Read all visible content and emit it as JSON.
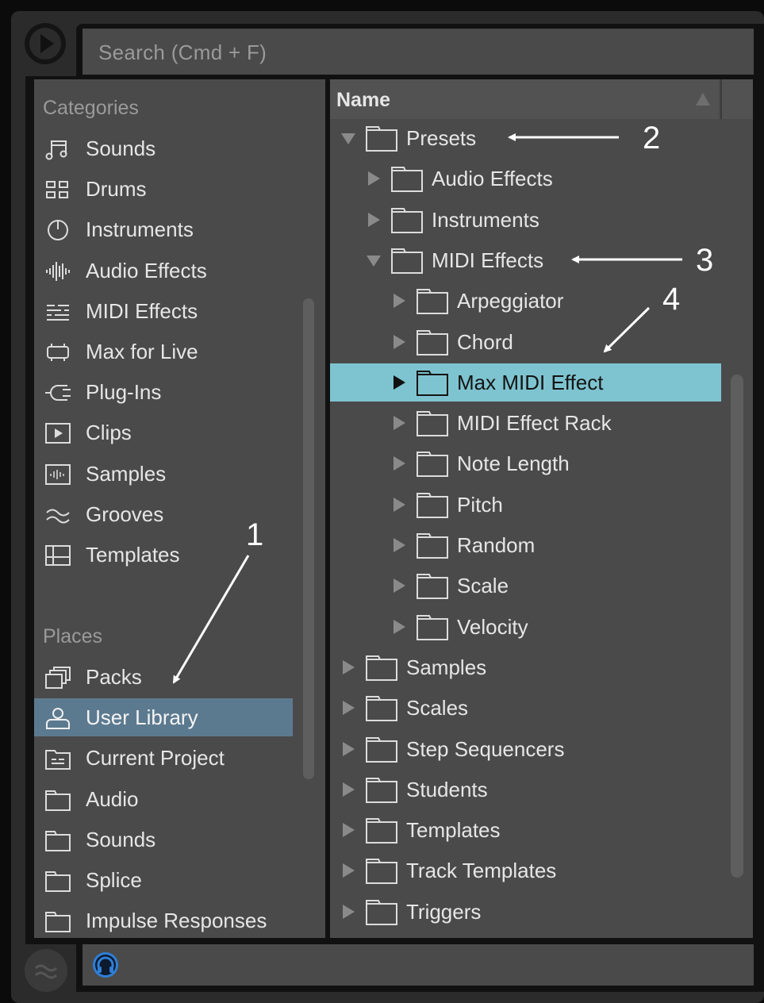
{
  "search": {
    "placeholder": "Search (Cmd + F)"
  },
  "sidebar": {
    "categories_label": "Categories",
    "categories": [
      {
        "label": "Sounds",
        "icon": "note-icon"
      },
      {
        "label": "Drums",
        "icon": "drum-grid-icon"
      },
      {
        "label": "Instruments",
        "icon": "power-icon"
      },
      {
        "label": "Audio Effects",
        "icon": "waveform-icon"
      },
      {
        "label": "MIDI Effects",
        "icon": "midi-lines-icon"
      },
      {
        "label": "Max for Live",
        "icon": "max-icon"
      },
      {
        "label": "Plug-Ins",
        "icon": "plug-icon"
      },
      {
        "label": "Clips",
        "icon": "clip-play-icon"
      },
      {
        "label": "Samples",
        "icon": "sample-wave-icon"
      },
      {
        "label": "Grooves",
        "icon": "groove-icon"
      },
      {
        "label": "Templates",
        "icon": "template-icon"
      }
    ],
    "places_label": "Places",
    "places": [
      {
        "label": "Packs",
        "icon": "packs-icon"
      },
      {
        "label": "User Library",
        "icon": "user-icon",
        "selected": true
      },
      {
        "label": "Current Project",
        "icon": "project-folder-icon"
      },
      {
        "label": "Audio",
        "icon": "folder-icon"
      },
      {
        "label": "Sounds",
        "icon": "folder-icon"
      },
      {
        "label": "Splice",
        "icon": "folder-icon"
      },
      {
        "label": "Impulse Responses",
        "icon": "folder-icon"
      }
    ]
  },
  "browser": {
    "column_header": "Name",
    "rows": [
      {
        "label": "Presets",
        "level": 0,
        "expanded": true
      },
      {
        "label": "Audio Effects",
        "level": 1,
        "expanded": false
      },
      {
        "label": "Instruments",
        "level": 1,
        "expanded": false
      },
      {
        "label": "MIDI Effects",
        "level": 1,
        "expanded": true
      },
      {
        "label": "Arpeggiator",
        "level": 2,
        "expanded": false
      },
      {
        "label": "Chord",
        "level": 2,
        "expanded": false
      },
      {
        "label": "Max MIDI Effect",
        "level": 2,
        "expanded": false,
        "selected": true
      },
      {
        "label": "MIDI Effect Rack",
        "level": 2,
        "expanded": false
      },
      {
        "label": "Note Length",
        "level": 2,
        "expanded": false
      },
      {
        "label": "Pitch",
        "level": 2,
        "expanded": false
      },
      {
        "label": "Random",
        "level": 2,
        "expanded": false
      },
      {
        "label": "Scale",
        "level": 2,
        "expanded": false
      },
      {
        "label": "Velocity",
        "level": 2,
        "expanded": false
      },
      {
        "label": "Samples",
        "level": 0,
        "expanded": false
      },
      {
        "label": "Scales",
        "level": 0,
        "expanded": false
      },
      {
        "label": "Step Sequencers",
        "level": 0,
        "expanded": false
      },
      {
        "label": "Students",
        "level": 0,
        "expanded": false
      },
      {
        "label": "Templates",
        "level": 0,
        "expanded": false
      },
      {
        "label": "Track Templates",
        "level": 0,
        "expanded": false
      },
      {
        "label": "Triggers",
        "level": 0,
        "expanded": false
      }
    ]
  },
  "annotations": [
    {
      "number": "1",
      "target": "User Library"
    },
    {
      "number": "2",
      "target": "Presets"
    },
    {
      "number": "3",
      "target": "MIDI Effects"
    },
    {
      "number": "4",
      "target": "Max MIDI Effect"
    }
  ],
  "colors": {
    "panel": "#4a4a4a",
    "selection_sidebar": "#5c7a8f",
    "selection_browser": "#7ec4d0",
    "status_icon": "#2f7fd6",
    "annotation": "#ffffff"
  }
}
